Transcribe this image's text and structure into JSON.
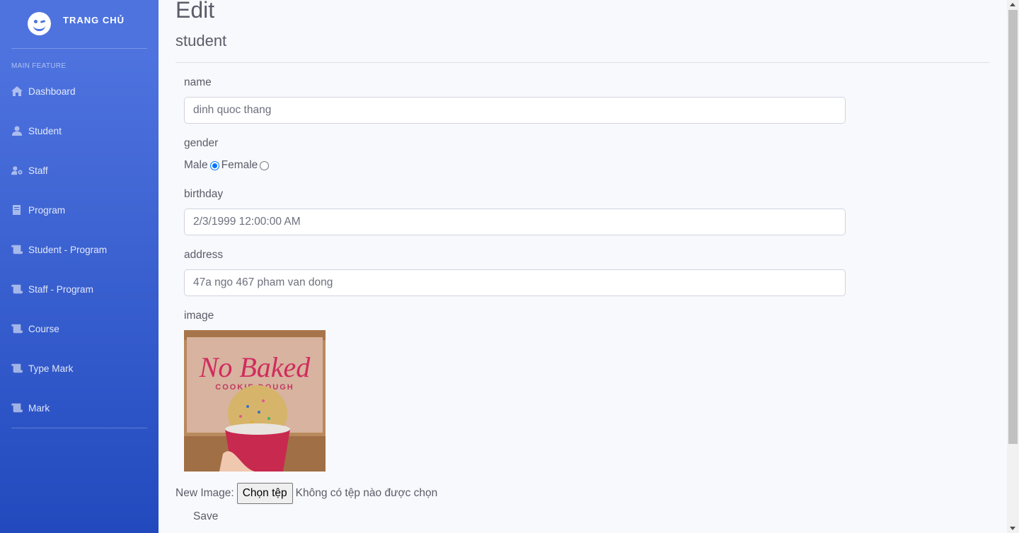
{
  "brand": {
    "title": "TRANG CHỦ",
    "icon": "laugh-wink-icon"
  },
  "sidebar": {
    "heading": "MAIN FEATURE",
    "items": [
      {
        "label": "Dashboard",
        "icon": "home-icon"
      },
      {
        "label": "Student",
        "icon": "user-icon"
      },
      {
        "label": "Staff",
        "icon": "user-cog-icon"
      },
      {
        "label": "Program",
        "icon": "book-icon"
      },
      {
        "label": "Student - Program",
        "icon": "scroll-icon"
      },
      {
        "label": "Staff - Program",
        "icon": "scroll-icon"
      },
      {
        "label": "Course",
        "icon": "scroll-icon"
      },
      {
        "label": "Type Mark",
        "icon": "scroll-icon"
      },
      {
        "label": "Mark",
        "icon": "scroll-icon"
      }
    ]
  },
  "page": {
    "title": "Edit",
    "subtitle": "student"
  },
  "form": {
    "name_label": "name",
    "name_value": "dinh quoc thang",
    "gender_label": "gender",
    "gender_male": "Male",
    "gender_female": "Female",
    "gender_selected": "Male",
    "birthday_label": "birthday",
    "birthday_value": "2/3/1999 12:00:00 AM",
    "address_label": "address",
    "address_value": "47a ngo 467 pham van dong",
    "image_label": "image",
    "image_text": "No Baked",
    "image_subtext": "COOKIE DOUGH",
    "new_image_label": "New Image:",
    "file_button": "Chọn tệp",
    "file_status": "Không có tệp nào được chọn",
    "save_label": "Save"
  },
  "colors": {
    "sidebar_top": "#4e73df",
    "sidebar_bottom": "#224abe",
    "background": "#f8f9fc",
    "radio_accent": "#0075ff"
  }
}
